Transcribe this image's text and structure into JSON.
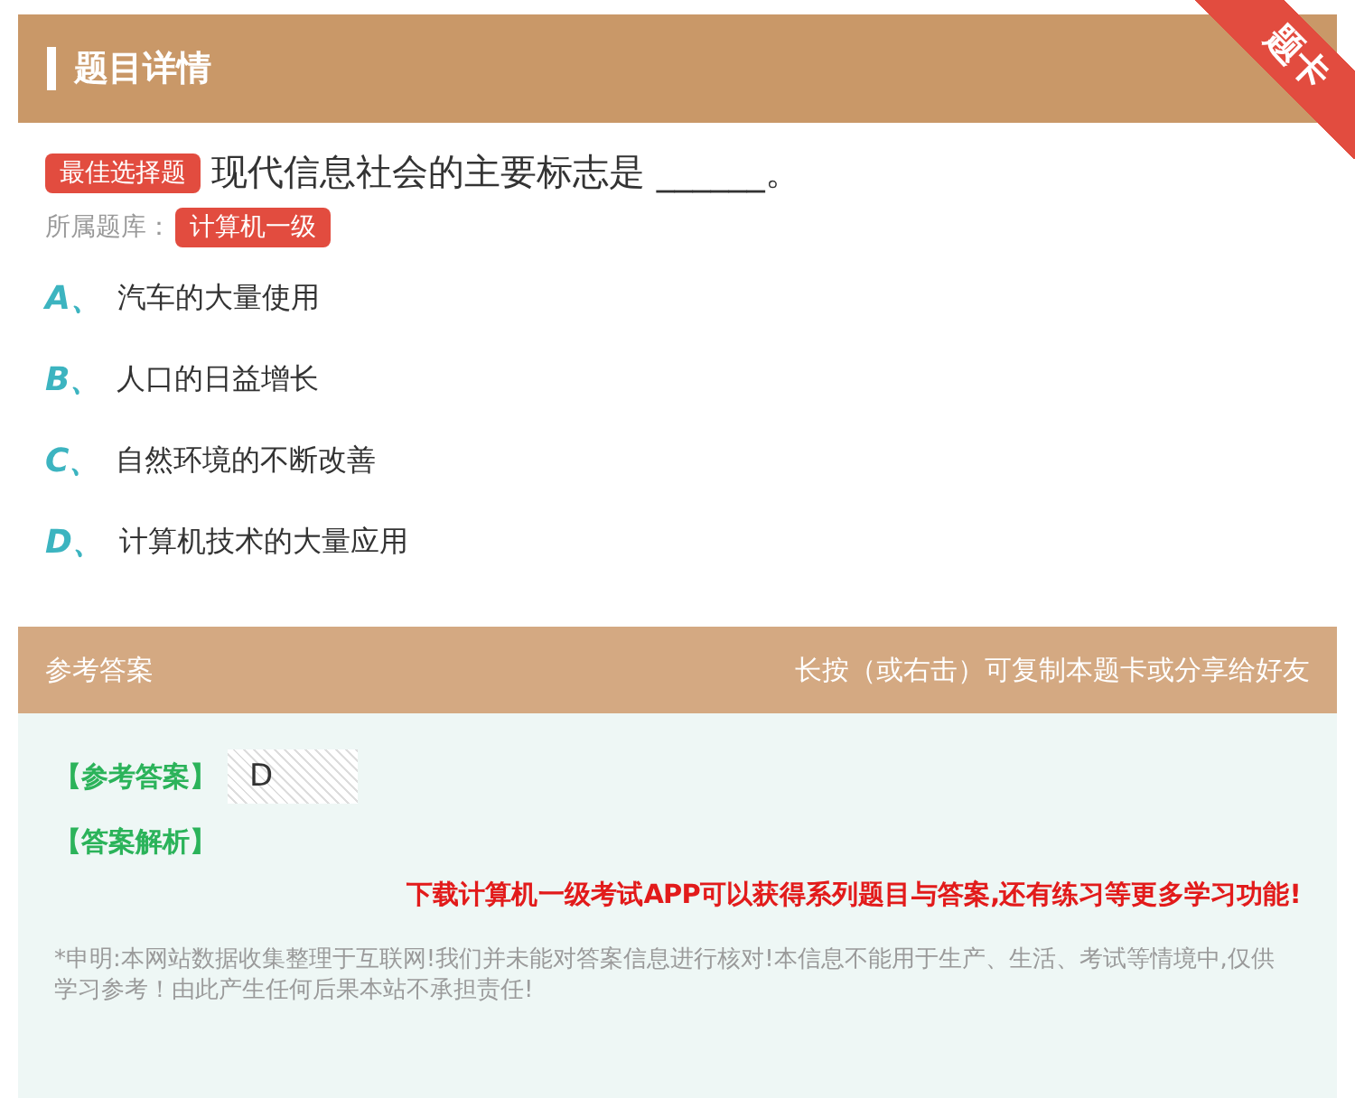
{
  "header": {
    "title": "题目详情",
    "ribbon": "题卡"
  },
  "question": {
    "type_badge": "最佳选择题",
    "text": "现代信息社会的主要标志是 ______。",
    "bank_label": "所属题库：",
    "bank_badge": "计算机一级"
  },
  "options": [
    {
      "letter": "A、",
      "text": "汽车的大量使用"
    },
    {
      "letter": "B、",
      "text": "人口的日益增长"
    },
    {
      "letter": "C、",
      "text": "自然环境的不断改善"
    },
    {
      "letter": "D、",
      "text": "计算机技术的大量应用"
    }
  ],
  "answer_bar": {
    "title": "参考答案",
    "hint": "长按（或右击）可复制本题卡或分享给好友"
  },
  "answer": {
    "label": "【参考答案】",
    "value": "D",
    "analysis_label": "【答案解析】",
    "promo": "下载计算机一级考试APP可以获得系列题目与答案,还有练习等更多学习功能!",
    "disclaimer": "*申明:本网站数据收集整理于互联网!我们并未能对答案信息进行核对!本信息不能用于生产、生活、考试等情境中,仅供学习参考！由此产生任何后果本站不承担责任!"
  }
}
